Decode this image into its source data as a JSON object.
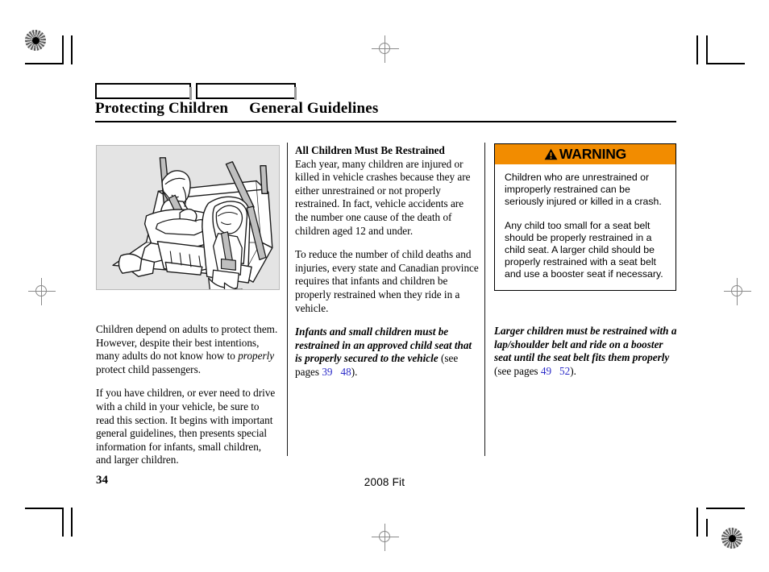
{
  "document": {
    "header": {
      "tabs": [
        {
          "label": ""
        },
        {
          "label": ""
        }
      ],
      "section_title": "Protecting Children",
      "subsection_title": "General Guidelines"
    },
    "figure": {
      "caption_alt": "rear-seat-children-restraints-illustration"
    },
    "left_column": {
      "paragraphs": [
        {
          "id": "p1",
          "segments": [
            {
              "text": "Children depend on adults to protect them. However, despite their best intentions, many adults do not know how to ",
              "style": "normal"
            },
            {
              "text": "properly",
              "style": "italic"
            },
            {
              "text": " protect child passengers.",
              "style": "normal"
            }
          ]
        },
        {
          "id": "p2",
          "segments": [
            {
              "text": "If you have children, or ever need to drive with a child in your vehicle, be sure to read this section. It begins with important general guidelines, then presents special information for infants, small children, and larger children.",
              "style": "normal"
            }
          ]
        }
      ]
    },
    "middle_column": {
      "heading": "All Children Must Be Restrained",
      "paragraphs": [
        {
          "id": "m1",
          "segments": [
            {
              "text": "Each year, many children are injured or killed in vehicle crashes because they are either unrestrained or not properly restrained. In fact, vehicle accidents are the number one cause of the death of children aged 12 and under.",
              "style": "normal"
            }
          ]
        },
        {
          "id": "m2",
          "segments": [
            {
              "text": "To reduce the number of child deaths and injuries, every state and Canadian province requires that infants and children be properly restrained when they ride in a vehicle.",
              "style": "normal"
            }
          ]
        },
        {
          "id": "m3",
          "segments": [
            {
              "text": "Infants and small children must be restrained in an approved child seat that is properly secured to the vehicle",
              "style": "bold-italic"
            },
            {
              "text": " (see pages ",
              "style": "normal"
            },
            {
              "text": "39",
              "style": "xref"
            },
            {
              "text": "48",
              "style": "xref"
            },
            {
              "text": ").",
              "style": "normal"
            }
          ]
        }
      ]
    },
    "warning": {
      "icon": "warning-triangle-icon",
      "label": "WARNING",
      "accent_color": "#f28c00",
      "paragraphs": [
        "Children who are unrestrained or improperly restrained can be seriously injured or killed in a crash.",
        "Any child too small for a seat belt should be properly restrained in a child seat. A larger child should be properly restrained with a seat belt and use a booster seat if necessary."
      ]
    },
    "right_column": {
      "paragraphs": [
        {
          "id": "r1",
          "segments": [
            {
              "text": "Larger children must be restrained with a lap/shoulder belt and ride on a booster seat until the seat belt fits them properly",
              "style": "bold-italic"
            },
            {
              "text": " (see pages ",
              "style": "normal"
            },
            {
              "text": "49",
              "style": "xref"
            },
            {
              "text": "52",
              "style": "xref"
            },
            {
              "text": ").",
              "style": "normal"
            }
          ]
        }
      ]
    },
    "footer": {
      "page_number": "34",
      "model_year_name": "2008  Fit"
    },
    "print_marks": {
      "registration_target": "registration-target-icon",
      "crosshair": "registration-crosshair-icon"
    }
  }
}
